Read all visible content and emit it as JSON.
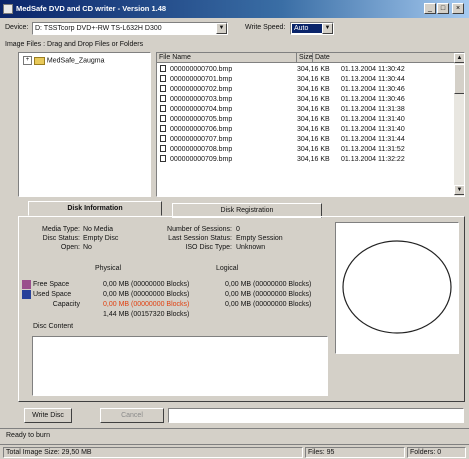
{
  "window": {
    "title": "MedSafe DVD and CD writer - Version 1.48",
    "min": "_",
    "max": "□",
    "close": "×"
  },
  "toolbar": {
    "device_label": "Device:",
    "device_value": "D: TSSTcorp DVD+-RW TS-L632H D300",
    "write_speed_label": "Write Speed:",
    "write_speed_value": "Auto"
  },
  "drag_label": "Image Files : Drag and Drop Files or Folders",
  "tree": {
    "root": "MedSafe_Zaugma"
  },
  "files": {
    "columns": {
      "name": "File Name",
      "size": "Size",
      "date": "Date"
    },
    "rows": [
      {
        "name": "000000000700.bmp",
        "size": "304,16 KB",
        "date": "01.13.2004 11:30:42"
      },
      {
        "name": "000000000701.bmp",
        "size": "304,16 KB",
        "date": "01.13.2004 11:30:44"
      },
      {
        "name": "000000000702.bmp",
        "size": "304,16 KB",
        "date": "01.13.2004 11:30:46"
      },
      {
        "name": "000000000703.bmp",
        "size": "304,16 KB",
        "date": "01.13.2004 11:30:46"
      },
      {
        "name": "000000000704.bmp",
        "size": "304,16 KB",
        "date": "01.13.2004 11:31:38"
      },
      {
        "name": "000000000705.bmp",
        "size": "304,16 KB",
        "date": "01.13.2004 11:31:40"
      },
      {
        "name": "000000000706.bmp",
        "size": "304,16 KB",
        "date": "01.13.2004 11:31:40"
      },
      {
        "name": "000000000707.bmp",
        "size": "304,16 KB",
        "date": "01.13.2004 11:31:44"
      },
      {
        "name": "000000000708.bmp",
        "size": "304,16 KB",
        "date": "01.13.2004 11:31:52"
      },
      {
        "name": "000000000709.bmp",
        "size": "304,16 KB",
        "date": "01.13.2004 11:32:22"
      }
    ]
  },
  "tabs": {
    "disk_info": "Disk Information",
    "disk_burn": "Disk Registration"
  },
  "disk": {
    "media_type_label": "Media Type:",
    "media_type_value": "No Media",
    "disc_status_label": "Disc Status:",
    "disc_status_value": "Empty Disc",
    "open_label": "Open:",
    "open_value": "No",
    "sessions_label": "Number of Sessions:",
    "sessions_value": "0",
    "last_session_label": "Last Session Status:",
    "last_session_value": "Empty Session",
    "iso_label": "ISO Disc Type:",
    "iso_value": "Unknown",
    "physical_header": "Physical",
    "logical_header": "Logical",
    "free_label": "Free Space",
    "used_label": "Used Space",
    "capacity_label": "Capacity",
    "free_physical": "0,00 MB (00000000 Blocks)",
    "used_physical": "0,00 MB (00000000 Blocks)",
    "capacity_physical": "0,00 MB (00000000 Blocks)",
    "total_physical": "1,44 MB (00157320 Blocks)",
    "free_logical": "0,00 MB (00000000 Blocks)",
    "used_logical": "0,00 MB (00000000 Blocks)",
    "capacity_logical": "0,00 MB (00000000 Blocks)",
    "content_label": "Disc Content"
  },
  "colors": {
    "free": "#9a4f8c",
    "used": "#27409a",
    "capacity_text": "#e04010"
  },
  "buttons": {
    "write": "Write Disc",
    "cancel": "Cancel"
  },
  "status": {
    "ready": "Ready to burn",
    "total_size": "Total Image Size: 29,50 MB",
    "files": "Files: 95",
    "folders": "Folders: 0"
  }
}
